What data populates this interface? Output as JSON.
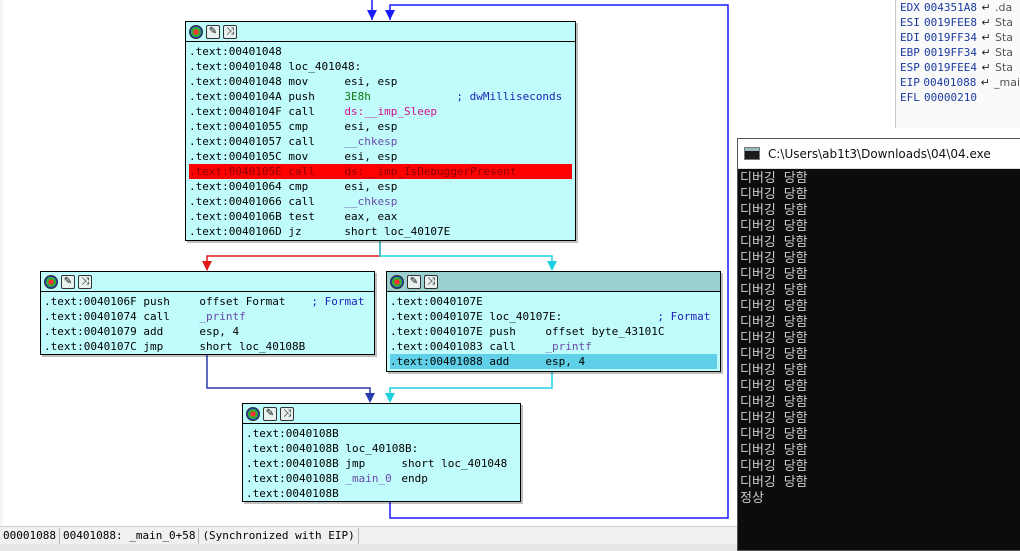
{
  "graph": {
    "node1": {
      "lines": [
        {
          "addr": ".text:00401048",
          "mn": "",
          "op": "",
          "hl": ""
        },
        {
          "addr": ".text:00401048",
          "mn": "loc_401048:",
          "op": "",
          "hl": ""
        },
        {
          "addr": ".text:00401048",
          "mn": "mov",
          "op": "esi, esp",
          "hl": ""
        },
        {
          "addr": ".text:0040104A",
          "mn": "push",
          "op": "3E8h",
          "cmt": "; dwMilliseconds",
          "hl": ""
        },
        {
          "addr": ".text:0040104F",
          "mn": "call",
          "op": "ds:__imp_Sleep",
          "hl": ""
        },
        {
          "addr": ".text:00401055",
          "mn": "cmp",
          "op": "esi, esp",
          "hl": ""
        },
        {
          "addr": ".text:00401057",
          "mn": "call",
          "op": "__chkesp",
          "hl": ""
        },
        {
          "addr": ".text:0040105C",
          "mn": "mov",
          "op": "esi, esp",
          "hl": ""
        },
        {
          "addr": ".text:0040105E",
          "mn": "call",
          "op": "ds:__imp_IsDebuggerPresent",
          "hl": "red"
        },
        {
          "addr": ".text:00401064",
          "mn": "cmp",
          "op": "esi, esp",
          "hl": ""
        },
        {
          "addr": ".text:00401066",
          "mn": "call",
          "op": "__chkesp",
          "hl": ""
        },
        {
          "addr": ".text:0040106B",
          "mn": "test",
          "op": "eax, eax",
          "hl": ""
        },
        {
          "addr": ".text:0040106D",
          "mn": "jz",
          "op": "short loc_40107E",
          "hl": ""
        }
      ]
    },
    "node2": {
      "lines": [
        {
          "addr": ".text:0040106F",
          "mn": "push",
          "op": "offset Format",
          "cmt": "; Format",
          "hl": ""
        },
        {
          "addr": ".text:00401074",
          "mn": "call",
          "op": "_printf",
          "hl": ""
        },
        {
          "addr": ".text:00401079",
          "mn": "add",
          "op": "esp, 4",
          "hl": ""
        },
        {
          "addr": ".text:0040107C",
          "mn": "jmp",
          "op": "short loc_40108B",
          "hl": ""
        }
      ]
    },
    "node3": {
      "lines": [
        {
          "addr": ".text:0040107E",
          "mn": "",
          "op": "",
          "hl": ""
        },
        {
          "addr": ".text:0040107E",
          "mn": "loc_40107E:",
          "op": "",
          "cmt": "; Format",
          "hl": ""
        },
        {
          "addr": ".text:0040107E",
          "mn": "push",
          "op": "offset byte_43101C",
          "hl": ""
        },
        {
          "addr": ".text:00401083",
          "mn": "call",
          "op": "_printf",
          "hl": ""
        },
        {
          "addr": ".text:00401088",
          "mn": "add",
          "op": "esp, 4",
          "hl": "blue"
        }
      ]
    },
    "node4": {
      "lines": [
        {
          "addr": ".text:0040108B",
          "mn": "",
          "op": "",
          "hl": ""
        },
        {
          "addr": ".text:0040108B",
          "mn": "loc_40108B:",
          "op": "",
          "hl": ""
        },
        {
          "addr": ".text:0040108B",
          "mn": "jmp",
          "op": "short loc_401048",
          "hl": ""
        },
        {
          "addr": ".text:0040108B",
          "mn": "_main_0",
          "op": "endp",
          "hl": ""
        },
        {
          "addr": ".text:0040108B",
          "mn": "",
          "op": "",
          "hl": ""
        }
      ]
    }
  },
  "registers": [
    {
      "name": "EDX",
      "value": "004351A8",
      "tag": ".da"
    },
    {
      "name": "ESI",
      "value": "0019FEE8",
      "tag": "Sta"
    },
    {
      "name": "EDI",
      "value": "0019FF34",
      "tag": "Sta"
    },
    {
      "name": "EBP",
      "value": "0019FF34",
      "tag": "Sta"
    },
    {
      "name": "ESP",
      "value": "0019FEE4",
      "tag": "Sta"
    },
    {
      "name": "EIP",
      "value": "00401088",
      "tag": "_mai"
    },
    {
      "name": "EFL",
      "value": "00000210",
      "tag": ""
    }
  ],
  "console": {
    "title": "C:\\Users\\ab1t3\\Downloads\\04\\04.exe",
    "lines": [
      "디버깅 당함",
      "디버깅 당함",
      "디버깅 당함",
      "디버깅 당함",
      "디버깅 당함",
      "디버깅 당함",
      "디버깅 당함",
      "디버깅 당함",
      "디버깅 당함",
      "디버깅 당함",
      "디버깅 당함",
      "디버깅 당함",
      "디버깅 당함",
      "디버깅 당함",
      "디버깅 당함",
      "디버깅 당함",
      "디버깅 당함",
      "디버깅 당함",
      "디버깅 당함",
      "디버깅 당함",
      "정상"
    ]
  },
  "statusbar": {
    "offset": "00001088",
    "location": "00401088: _main_0+58",
    "sync": "(Synchronized with EIP)"
  },
  "icons": {
    "node_header": [
      "color-wheel-icon",
      "pencil-icon",
      "graph-icon"
    ],
    "register_arrow": "return-arrow-icon"
  }
}
